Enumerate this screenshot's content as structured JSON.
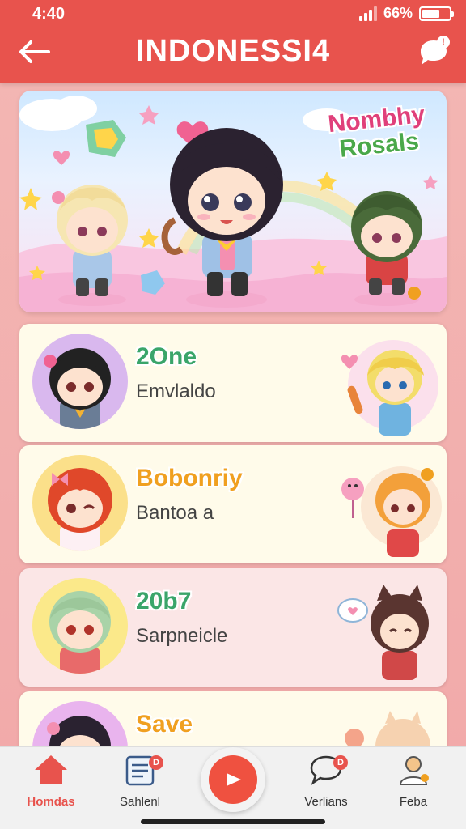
{
  "status": {
    "time": "4:40",
    "battery_pct": "66%",
    "battery_level": 0.66
  },
  "header": {
    "title": "INDONESSI4",
    "chat_badge": "!"
  },
  "hero": {
    "title_line1": "Nombhy",
    "title_line2": "Rosals"
  },
  "cards": [
    {
      "title": "2One",
      "subtitle": "Emvlaldo",
      "title_color": "#3aa56a"
    },
    {
      "title": "Bobonriy",
      "subtitle": "Bantoa a",
      "title_color": "#f0a020"
    },
    {
      "title": "20b7",
      "subtitle": "Sarpneicle",
      "title_color": "#3aa56a"
    },
    {
      "title": "Save",
      "subtitle": "",
      "title_color": "#f0a020"
    }
  ],
  "nav": {
    "items": [
      {
        "label": "Homdas"
      },
      {
        "label": "Sahlenl",
        "badge": "D"
      },
      {
        "label": "Verlians",
        "badge": "D"
      },
      {
        "label": "Feba"
      }
    ]
  },
  "colors": {
    "accent": "#e8534d",
    "background": "#f3b7b4"
  }
}
